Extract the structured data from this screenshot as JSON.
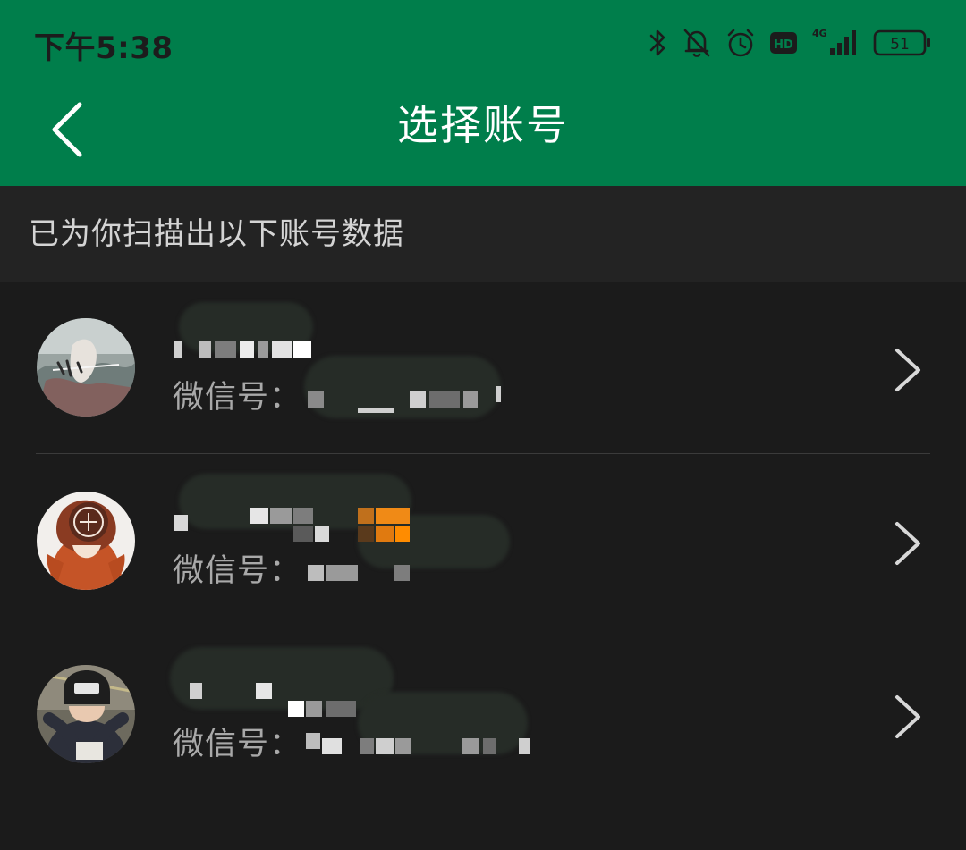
{
  "status_bar": {
    "time": "下午5:38",
    "icons": [
      "bluetooth-icon",
      "bell-muted-icon",
      "alarm-icon",
      "hd-icon",
      "4g-signal-icon",
      "battery-icon"
    ],
    "network": "4G",
    "hd": "HD",
    "battery": "51"
  },
  "nav": {
    "title": "选择账号",
    "back_icon": "chevron-left-icon"
  },
  "subheader": {
    "text": "已为你扫描出以下账号数据"
  },
  "accounts": [
    {
      "wxid_label": "微信号：",
      "name_redacted": true,
      "wxid_redacted": true
    },
    {
      "wxid_label": "微信号：",
      "name_redacted": true,
      "wxid_redacted": true
    },
    {
      "wxid_label": "微信号：",
      "name_redacted": true,
      "wxid_redacted": true
    }
  ],
  "colors": {
    "accent_green": "#007e4b",
    "background": "#1b1b1b",
    "subheader_bg": "#232323",
    "divider": "#3b3b3b"
  }
}
